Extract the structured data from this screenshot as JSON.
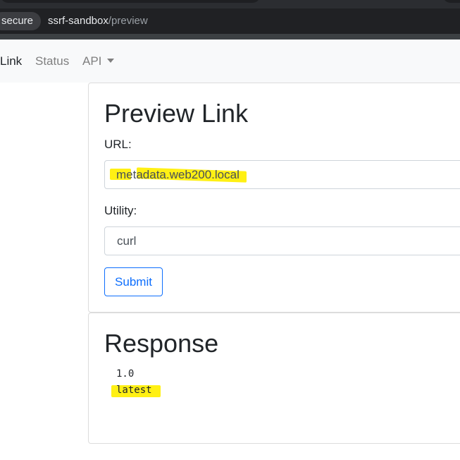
{
  "browser": {
    "secure_label": "secure",
    "url_host": "ssrf-sandbox",
    "url_path": "/preview"
  },
  "navbar": {
    "items": [
      {
        "label": "Link",
        "active": true
      },
      {
        "label": "Status",
        "active": false
      },
      {
        "label": "API",
        "active": false,
        "dropdown": true
      }
    ]
  },
  "preview_card": {
    "title": "Preview Link",
    "url_label": "URL:",
    "url_value": "metadata.web200.local",
    "utility_label": "Utility:",
    "utility_value": "curl",
    "submit_label": "Submit"
  },
  "response_card": {
    "title": "Response",
    "lines": [
      "1.0",
      "latest"
    ]
  },
  "colors": {
    "highlight": "#ffef00",
    "primary": "#0d6efd",
    "navbar_bg": "#f8f9fa"
  }
}
